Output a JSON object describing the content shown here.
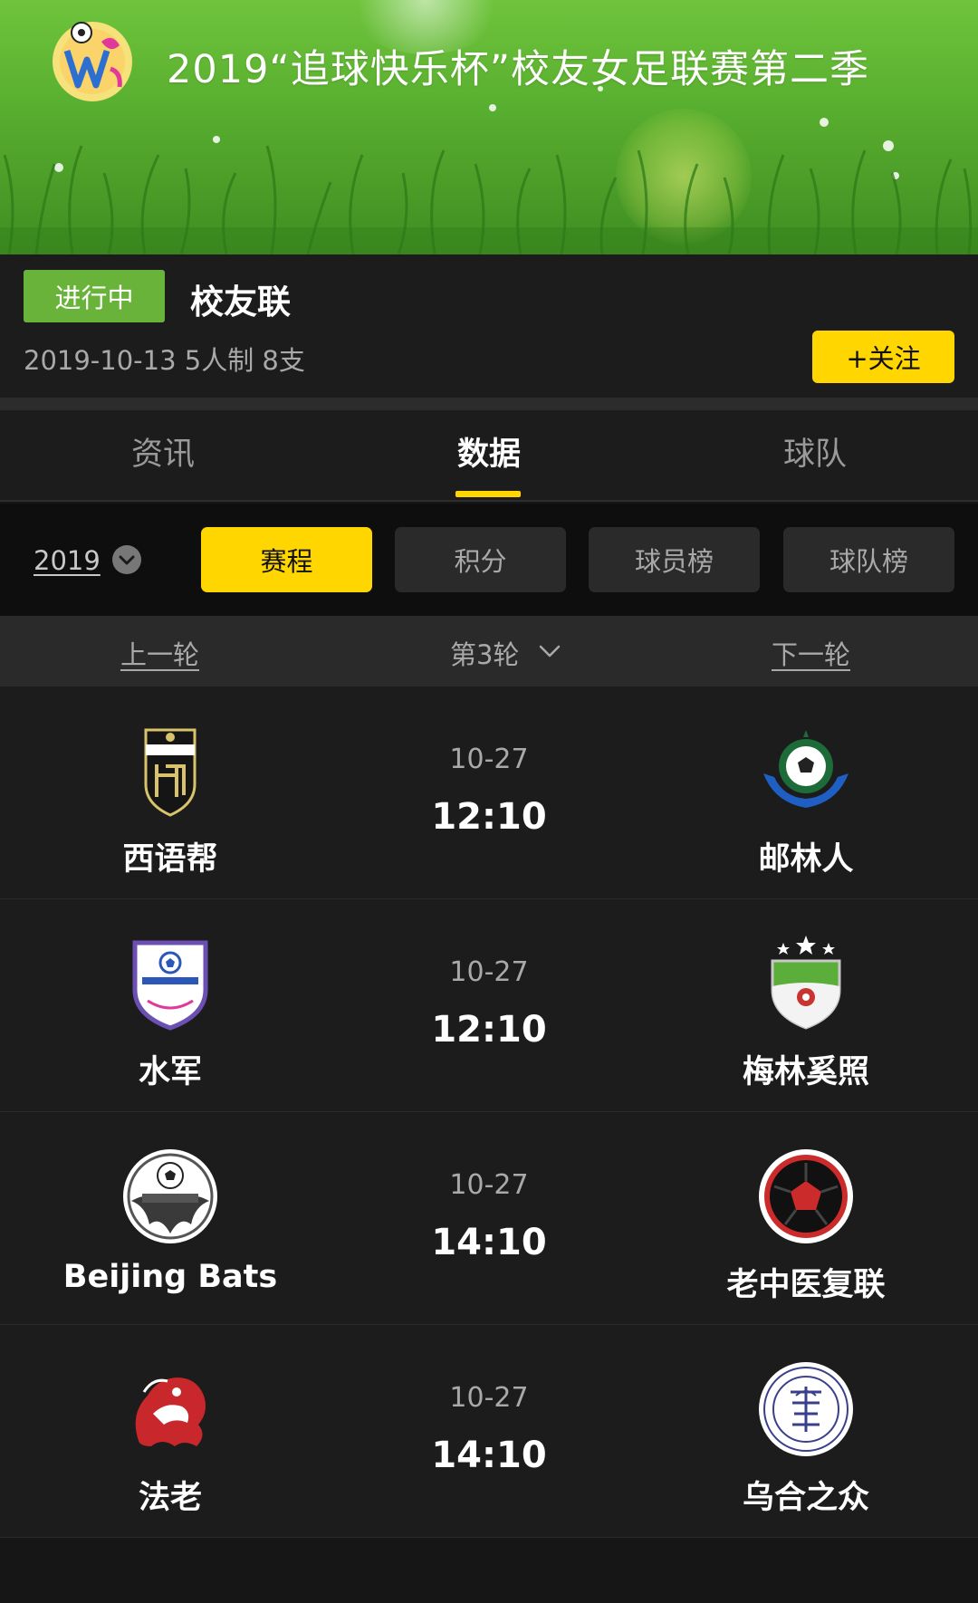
{
  "banner": {
    "title": "2019“追球快乐杯”校友女足联赛第二季",
    "logo_icon": "league-logo-icon"
  },
  "info": {
    "status": "进行中",
    "league_name": "校友联",
    "meta": "2019-10-13 5人制 8支",
    "follow_label": "+关注"
  },
  "tabs": [
    {
      "label": "资讯",
      "active": false
    },
    {
      "label": "数据",
      "active": true
    },
    {
      "label": "球队",
      "active": false
    }
  ],
  "filters": {
    "year": "2019",
    "pills": [
      {
        "label": "赛程",
        "active": true
      },
      {
        "label": "积分",
        "active": false
      },
      {
        "label": "球员榜",
        "active": false
      },
      {
        "label": "球队榜",
        "active": false
      }
    ]
  },
  "round_nav": {
    "prev": "上一轮",
    "current": "第3轮",
    "next": "下一轮"
  },
  "matches": [
    {
      "home": "西语帮",
      "away": "邮林人",
      "date": "10-27",
      "time": "12:10",
      "home_crest": "shield-crest-icon",
      "away_crest": "ball-emblem-icon"
    },
    {
      "home": "水军",
      "away": "梅林奚照",
      "date": "10-27",
      "time": "12:10",
      "home_crest": "shield-crest-icon",
      "away_crest": "star-shield-icon"
    },
    {
      "home": "Beijing Bats",
      "away": "老中医复联",
      "date": "10-27",
      "time": "14:10",
      "home_crest": "bat-ball-icon",
      "away_crest": "ball-circle-icon"
    },
    {
      "home": "法老",
      "away": "乌合之众",
      "date": "10-27",
      "time": "14:10",
      "home_crest": "dragon-icon",
      "away_crest": "seal-icon"
    }
  ],
  "colors": {
    "accent": "#ffd600",
    "status_green": "#6ab33a",
    "background": "#1c1c1c"
  }
}
